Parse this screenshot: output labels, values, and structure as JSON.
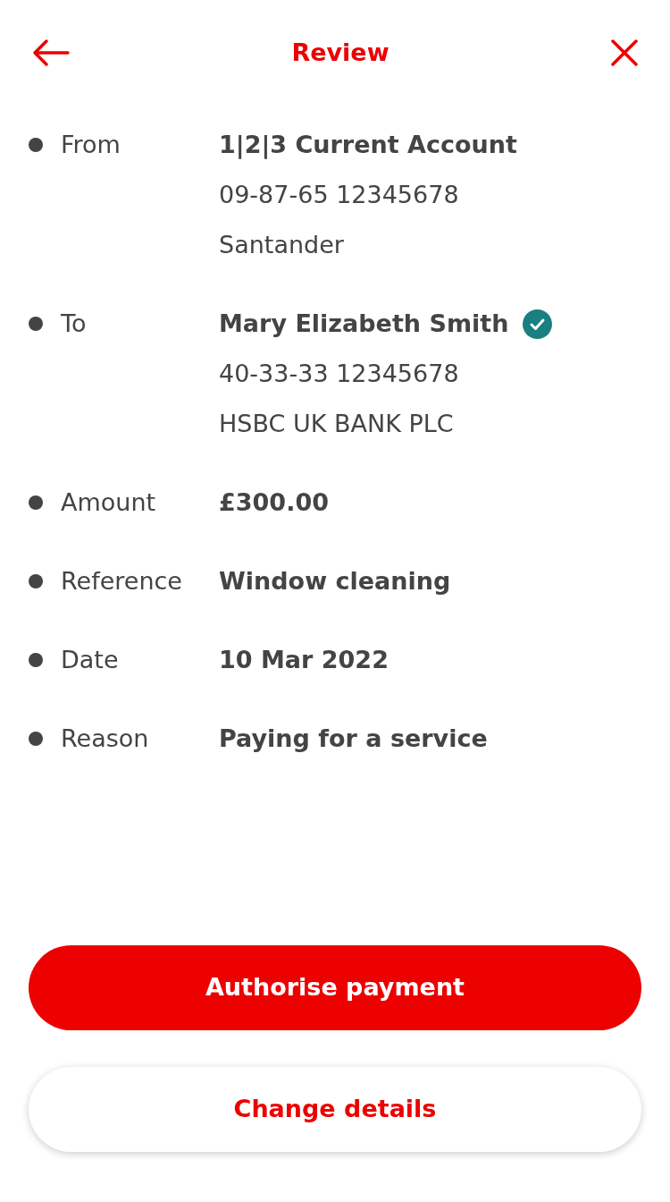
{
  "header": {
    "title": "Review"
  },
  "rows": [
    {
      "label": "From",
      "verified": false,
      "value": "1|2|3 Current Account",
      "details": [
        "09-87-65 12345678",
        "Santander"
      ]
    },
    {
      "label": "To",
      "verified": true,
      "value": "Mary Elizabeth Smith",
      "details": [
        "40-33-33 12345678",
        "HSBC UK BANK PLC"
      ]
    },
    {
      "label": "Amount",
      "verified": false,
      "value": "£300.00"
    },
    {
      "label": "Reference",
      "verified": false,
      "value": "Window cleaning"
    },
    {
      "label": "Date",
      "verified": false,
      "value": "10 Mar 2022"
    },
    {
      "label": "Reason",
      "verified": false,
      "value": "Paying for a service"
    }
  ],
  "buttons": [
    {
      "label": "Authorise payment",
      "kind": "primary"
    },
    {
      "label": "Change details",
      "kind": "secondary"
    }
  ]
}
